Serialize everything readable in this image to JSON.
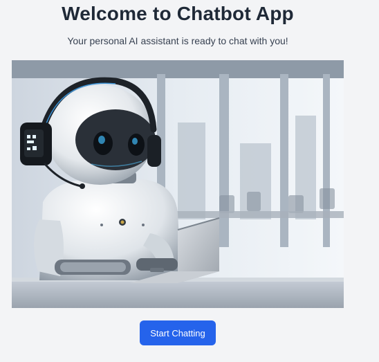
{
  "page": {
    "title": "Welcome to Chatbot App",
    "subtitle": "Your personal AI assistant is ready to chat with you!"
  },
  "hero_image": {
    "subject": "robot-with-headset-and-laptop"
  },
  "actions": {
    "start_label": "Start Chatting"
  },
  "colors": {
    "background": "#f3f4f6",
    "title": "#1f2937",
    "button": "#2563eb",
    "button_text": "#ffffff"
  }
}
